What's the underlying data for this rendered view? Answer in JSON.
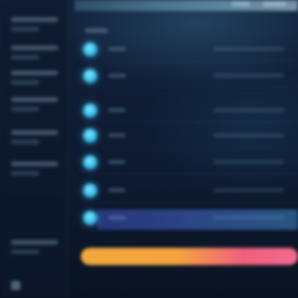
{
  "sidebar": {
    "items": [
      {
        "label": "",
        "sub": ""
      },
      {
        "label": "",
        "sub": ""
      },
      {
        "label": "",
        "sub": ""
      },
      {
        "label": "",
        "sub": ""
      },
      {
        "label": "",
        "sub": ""
      },
      {
        "label": "",
        "sub": ""
      },
      {
        "label": "",
        "sub": ""
      }
    ]
  },
  "list": {
    "header": "",
    "rows": [
      {
        "label": "",
        "value": ""
      },
      {
        "label": "",
        "value": ""
      },
      {
        "label": "",
        "value": ""
      },
      {
        "label": "",
        "value": ""
      },
      {
        "label": "",
        "value": ""
      },
      {
        "label": "",
        "value": ""
      },
      {
        "label": "",
        "value": ""
      }
    ]
  },
  "progress": {
    "fraction": 1.0
  },
  "colors": {
    "accent_dot": "#3ec3ec",
    "highlight_band": "#4a6ad0",
    "progress_start": "#f2a93a",
    "progress_end": "#f06a8e",
    "background": "#0b1424"
  },
  "icons": {
    "row_status": "status-dot-icon",
    "sidebar_bottom": "menu-icon"
  }
}
